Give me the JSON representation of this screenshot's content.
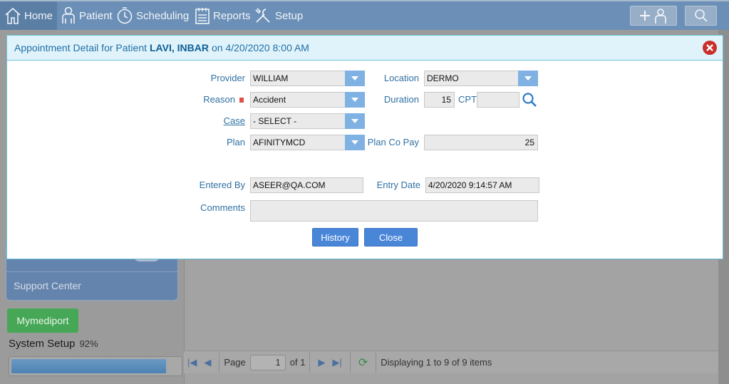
{
  "nav": {
    "home": "Home",
    "patient": "Patient",
    "scheduling": "Scheduling",
    "reports": "Reports",
    "setup": "Setup"
  },
  "sidebar": {
    "support": "Support Center",
    "mymediport": "Mymediport",
    "system_setup": "System Setup",
    "system_setup_pct": "92%",
    "system_setup_progress": 0.92
  },
  "pager": {
    "page_label": "Page",
    "page_value": "1",
    "of_label": "of 1",
    "status": "Displaying 1 to 9 of 9 items"
  },
  "modal": {
    "title_prefix": "Appointment Detail for Patient",
    "patient_name": "LAVI, INBAR",
    "title_suffix": "on 4/20/2020 8:00 AM",
    "provider_label": "Provider",
    "provider_value": "WILLIAM",
    "location_label": "Location",
    "location_value": "DERMO",
    "reason_label": "Reason",
    "reason_value": "Accident",
    "duration_label": "Duration",
    "duration_value": "15",
    "cpt_label": "CPT",
    "cpt_value": "",
    "case_label": "Case",
    "case_value": "- SELECT -",
    "plan_label": "Plan",
    "plan_value": "AFINITYMCD",
    "copay_label": "Plan Co Pay",
    "copay_value": "25",
    "entered_by_label": "Entered By",
    "entered_by_value": "ASEER@QA.COM",
    "entry_date_label": "Entry Date",
    "entry_date_value": "4/20/2020 9:14:57 AM",
    "comments_label": "Comments",
    "comments_value": "",
    "history_button": "History",
    "close_button": "Close"
  },
  "colors": {
    "nav_bg": "#6b8fb6",
    "modal_header_bg": "#e1f3fa",
    "accent_blue": "#4a86d8",
    "label_blue": "#2f70a3",
    "close_red": "#c9302c",
    "green_button": "#46a856"
  }
}
